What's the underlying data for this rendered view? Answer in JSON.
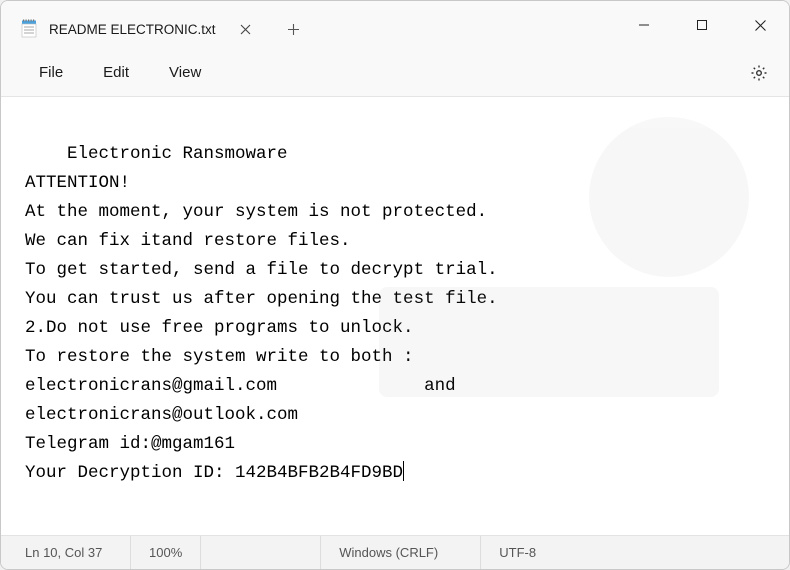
{
  "tab": {
    "title": "README ELECTRONIC.txt"
  },
  "menu": {
    "file": "File",
    "edit": "Edit",
    "view": "View"
  },
  "content": {
    "line1": "Electronic Ransmoware",
    "line2": "ATTENTION!",
    "line3": "At the moment, your system is not protected.",
    "line4": "We can fix itand restore files.",
    "line5": "To get started, send a file to decrypt trial.",
    "line6": "You can trust us after opening the test file.",
    "line7": "2.Do not use free programs to unlock.",
    "line8": "To restore the system write to both :",
    "line9": "electronicrans@gmail.com              and",
    "line10": "electronicrans@outlook.com",
    "line11": "Telegram id:@mgam161",
    "line12": "Your Decryption ID: 142B4BFB2B4FD9BD"
  },
  "status": {
    "position": "Ln 10, Col 37",
    "zoom": "100%",
    "line_ending": "Windows (CRLF)",
    "encoding": "UTF-8"
  }
}
